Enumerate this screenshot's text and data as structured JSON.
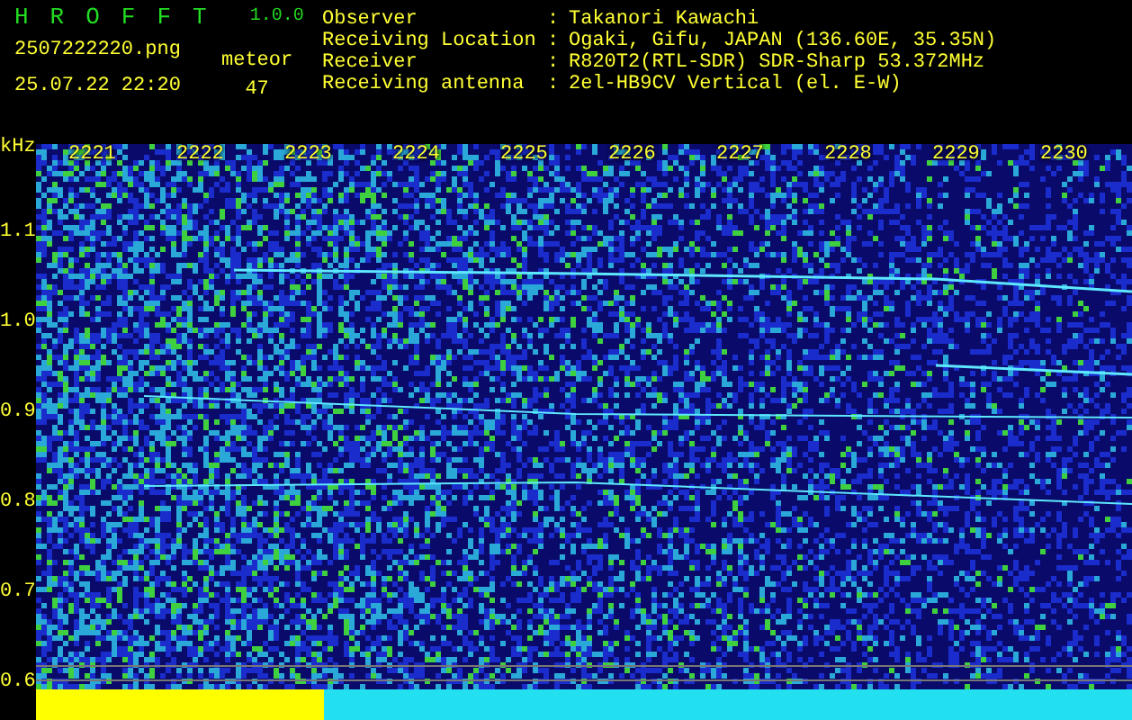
{
  "app": {
    "name": "HROFFT",
    "version": "1.0.0"
  },
  "file": {
    "name": "2507222220.png",
    "datetime": "25.07.22 22:20"
  },
  "count": {
    "label": "meteor",
    "value": "47"
  },
  "info": [
    {
      "label": "Observer",
      "separator": ":",
      "value": "Takanori Kawachi"
    },
    {
      "label": "Receiving Location",
      "separator": ":",
      "value": "Ogaki, Gifu, JAPAN (136.60E, 35.35N)"
    },
    {
      "label": "Receiver",
      "separator": ":",
      "value": "R820T2(RTL-SDR) SDR-Sharp 53.372MHz"
    },
    {
      "label": "Receiving antenna",
      "separator": ":",
      "value": "2el-HB9CV Vertical (el. E-W)"
    }
  ],
  "spectrogram": {
    "unit": "kHz",
    "time_labels": [
      "2221",
      "2222",
      "2223",
      "2224",
      "2225",
      "2226",
      "2227",
      "2228",
      "2229",
      "2230"
    ],
    "freq_labels": [
      "1.1",
      "1.0",
      "0.9",
      "0.8",
      "0.7",
      "0.6"
    ]
  }
}
